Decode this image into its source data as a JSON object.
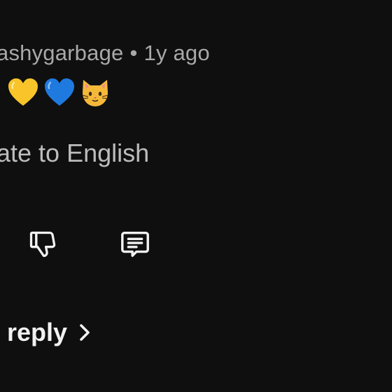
{
  "comment": {
    "author": "ashygarbage",
    "separator": "•",
    "time": "1y ago",
    "emoji_icons": [
      "yellow-heart-icon",
      "blue-heart-icon",
      "cat-face-icon"
    ],
    "translate_label": "ate to English",
    "reply_count_label": "l reply"
  },
  "colors": {
    "background": "#0f0f0f",
    "meta_text": "#a8a8a8",
    "primary_text": "#f1f1f1",
    "yellow_heart": "#f8c42a",
    "blue_heart": "#1f7ae0",
    "cat": "#f5b93a"
  },
  "icons": {
    "dislike": "thumbs-down-icon",
    "reply": "comment-icon",
    "expand": "chevron-right-icon"
  }
}
